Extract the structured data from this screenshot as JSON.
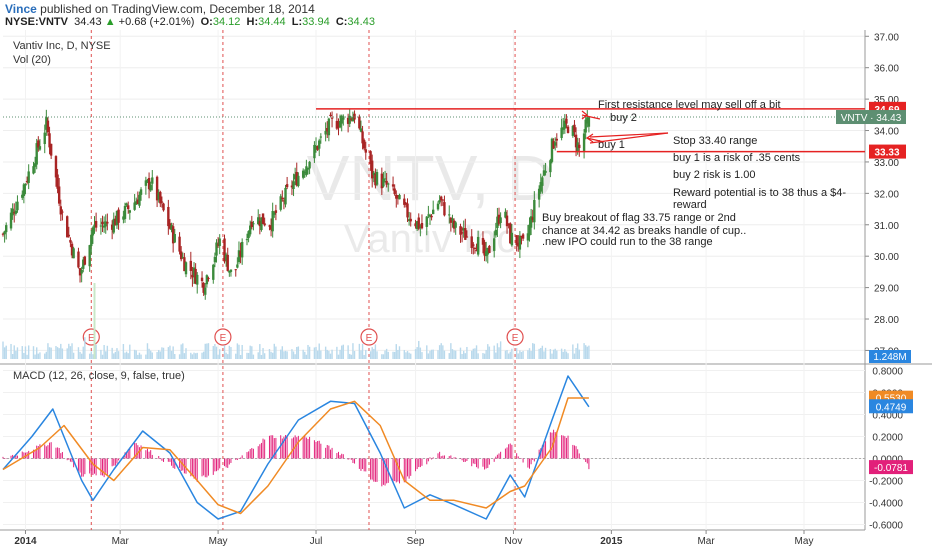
{
  "header": {
    "author": "Vince",
    "published_text": "published on TradingView.com, December 18, 2014",
    "symbol": "NYSE:VNTV",
    "last": "34.43",
    "change": "+0.68 (+2.01%)",
    "o_label": "O:",
    "o_value": "34.12",
    "h_label": "H:",
    "h_value": "34.44",
    "l_label": "L:",
    "l_value": "33.94",
    "c_label": "C:",
    "c_value": "34.43"
  },
  "chart_data": [
    {
      "type": "candlestick",
      "title": "Vantiv Inc, D, NYSE",
      "volume_label": "Vol (20)",
      "watermark_symbol": "VNTV, D",
      "watermark_name": "Vantiv Inc",
      "x_ticks": [
        "2014",
        "Mar",
        "May",
        "Jul",
        "Sep",
        "Nov",
        "2015",
        "Mar",
        "May"
      ],
      "y_ticks": [
        "37.00",
        "36.00",
        "35.00",
        "34.00",
        "33.00",
        "32.00",
        "31.00",
        "30.00",
        "29.00",
        "28.00",
        "27.00"
      ],
      "ylim": [
        26.6,
        37.2
      ],
      "price_path": [
        [
          "2013-12-18",
          30.7
        ],
        [
          "2014-01-02",
          32.5
        ],
        [
          "2014-01-14",
          34.2
        ],
        [
          "2014-01-24",
          31.3
        ],
        [
          "2014-02-04",
          29.4
        ],
        [
          "2014-02-12",
          30.9
        ],
        [
          "2014-02-25",
          31.1
        ],
        [
          "2014-03-08",
          31.6
        ],
        [
          "2014-03-20",
          32.4
        ],
        [
          "2014-04-01",
          30.9
        ],
        [
          "2014-04-10",
          29.8
        ],
        [
          "2014-04-22",
          29.1
        ],
        [
          "2014-05-02",
          30.5
        ],
        [
          "2014-05-10",
          29.3
        ],
        [
          "2014-05-22",
          31.2
        ],
        [
          "2014-06-03",
          31.1
        ],
        [
          "2014-06-15",
          32.2
        ],
        [
          "2014-06-27",
          33.1
        ],
        [
          "2014-07-10",
          34.2
        ],
        [
          "2014-07-25",
          34.5
        ],
        [
          "2014-08-05",
          32.6
        ],
        [
          "2014-08-15",
          32.2
        ],
        [
          "2014-08-26",
          31.4
        ],
        [
          "2014-09-05",
          30.9
        ],
        [
          "2014-09-16",
          31.8
        ],
        [
          "2014-09-25",
          30.9
        ],
        [
          "2014-10-10",
          30.4
        ],
        [
          "2014-10-15",
          29.9
        ],
        [
          "2014-10-25",
          31.6
        ],
        [
          "2014-10-30",
          30.6
        ],
        [
          "2014-11-08",
          30.3
        ],
        [
          "2014-11-17",
          32.2
        ],
        [
          "2014-11-27",
          33.8
        ],
        [
          "2014-12-06",
          34.2
        ],
        [
          "2014-12-12",
          33.4
        ],
        [
          "2014-12-18",
          34.43
        ]
      ],
      "earnings_markers": [
        {
          "date": "2014-02-11",
          "label": "E"
        },
        {
          "date": "2014-05-04",
          "label": "E"
        },
        {
          "date": "2014-08-03",
          "label": "E"
        },
        {
          "date": "2014-11-02",
          "label": "E"
        }
      ],
      "horizontal_lines": [
        {
          "price": 34.69,
          "label": "34.69",
          "color": "#e52222",
          "start": "2014-07-01"
        },
        {
          "price": 33.33,
          "label": "33.33",
          "color": "#e52222",
          "start": "2014-11-28"
        }
      ],
      "last_price": {
        "price": 34.43,
        "label": "VNTV · 34.43",
        "color": "#5d8f72"
      },
      "volume_tag": {
        "label": "1.248M",
        "color": "#2a86e0"
      },
      "annotations": [
        {
          "text": "First resistance level may sell off a bit",
          "color": "#222"
        },
        {
          "text": "buy 2",
          "color": "#222"
        },
        {
          "text": "Stop 33.40 range",
          "color": "#222"
        },
        {
          "text": "buy 1",
          "color": "#222"
        },
        {
          "text": "buy 1 is a risk of .35 cents",
          "color": "#222"
        },
        {
          "text": "buy 2 risk is 1.00",
          "color": "#222"
        },
        {
          "text": "Reward potential is to 38 thus a $4-",
          "color": "#222"
        },
        {
          "text": "reward",
          "color": "#222"
        },
        {
          "text": "Buy breakout of flag  33.75 range or 2nd",
          "color": "#222"
        },
        {
          "text": "chance at 34.42 as breaks handle of cup..",
          "color": "#222"
        },
        {
          "text": ".new IPO could run to the 38 range",
          "color": "#222"
        }
      ]
    },
    {
      "type": "macd",
      "label": "MACD (12, 26, close, 9, false, true)",
      "y_ticks": [
        "0.8000",
        "0.6000",
        "0.4000",
        "0.2000",
        "0.0000",
        "-0.2000",
        "-0.4000",
        "-0.6000"
      ],
      "ylim": [
        -0.65,
        0.85
      ],
      "macd_tag": {
        "label": "0.4749",
        "color": "#2a86e0"
      },
      "signal_tag": {
        "label": "0.5530",
        "color": "#f08a24"
      },
      "hist_tag": {
        "label": "-0.0781",
        "color": "#e2207a"
      },
      "macd_line": [
        [
          "2013-12-18",
          -0.1
        ],
        [
          "2014-01-05",
          0.2
        ],
        [
          "2014-01-18",
          0.45
        ],
        [
          "2014-02-05",
          -0.2
        ],
        [
          "2014-02-12",
          -0.38
        ],
        [
          "2014-02-25",
          -0.1
        ],
        [
          "2014-03-15",
          0.25
        ],
        [
          "2014-04-01",
          0.05
        ],
        [
          "2014-04-18",
          -0.4
        ],
        [
          "2014-05-01",
          -0.55
        ],
        [
          "2014-05-15",
          -0.48
        ],
        [
          "2014-06-01",
          -0.05
        ],
        [
          "2014-06-20",
          0.35
        ],
        [
          "2014-07-10",
          0.52
        ],
        [
          "2014-07-25",
          0.5
        ],
        [
          "2014-08-10",
          0.05
        ],
        [
          "2014-08-25",
          -0.45
        ],
        [
          "2014-09-10",
          -0.33
        ],
        [
          "2014-09-25",
          -0.42
        ],
        [
          "2014-10-15",
          -0.55
        ],
        [
          "2014-10-30",
          -0.15
        ],
        [
          "2014-11-08",
          -0.35
        ],
        [
          "2014-11-25",
          0.35
        ],
        [
          "2014-12-05",
          0.75
        ],
        [
          "2014-12-18",
          0.47
        ]
      ],
      "signal_line": [
        [
          "2013-12-18",
          -0.1
        ],
        [
          "2014-01-10",
          0.1
        ],
        [
          "2014-01-25",
          0.3
        ],
        [
          "2014-02-12",
          -0.05
        ],
        [
          "2014-02-25",
          -0.2
        ],
        [
          "2014-03-15",
          0.1
        ],
        [
          "2014-04-01",
          0.08
        ],
        [
          "2014-04-18",
          -0.2
        ],
        [
          "2014-05-01",
          -0.42
        ],
        [
          "2014-05-15",
          -0.5
        ],
        [
          "2014-06-01",
          -0.25
        ],
        [
          "2014-06-20",
          0.15
        ],
        [
          "2014-07-10",
          0.45
        ],
        [
          "2014-07-25",
          0.52
        ],
        [
          "2014-08-10",
          0.3
        ],
        [
          "2014-08-25",
          -0.2
        ],
        [
          "2014-09-10",
          -0.38
        ],
        [
          "2014-09-25",
          -0.38
        ],
        [
          "2014-10-15",
          -0.45
        ],
        [
          "2014-10-30",
          -0.3
        ],
        [
          "2014-11-08",
          -0.25
        ],
        [
          "2014-11-25",
          0.1
        ],
        [
          "2014-12-05",
          0.55
        ],
        [
          "2014-12-18",
          0.55
        ]
      ],
      "histogram_peaks": [
        [
          "2013-12-18",
          0.0
        ],
        [
          "2014-01-08",
          0.1
        ],
        [
          "2014-01-18",
          0.15
        ],
        [
          "2014-02-05",
          -0.15
        ],
        [
          "2014-02-20",
          -0.15
        ],
        [
          "2014-03-10",
          0.15
        ],
        [
          "2014-04-01",
          -0.05
        ],
        [
          "2014-04-18",
          -0.2
        ],
        [
          "2014-05-10",
          -0.05
        ],
        [
          "2014-06-01",
          0.2
        ],
        [
          "2014-06-25",
          0.2
        ],
        [
          "2014-07-20",
          0.02
        ],
        [
          "2014-08-10",
          -0.25
        ],
        [
          "2014-08-25",
          -0.2
        ],
        [
          "2014-09-15",
          0.05
        ],
        [
          "2014-10-15",
          -0.1
        ],
        [
          "2014-10-30",
          0.15
        ],
        [
          "2014-11-10",
          -0.1
        ],
        [
          "2014-11-25",
          0.25
        ],
        [
          "2014-12-05",
          0.2
        ],
        [
          "2014-12-18",
          -0.08
        ]
      ]
    }
  ]
}
